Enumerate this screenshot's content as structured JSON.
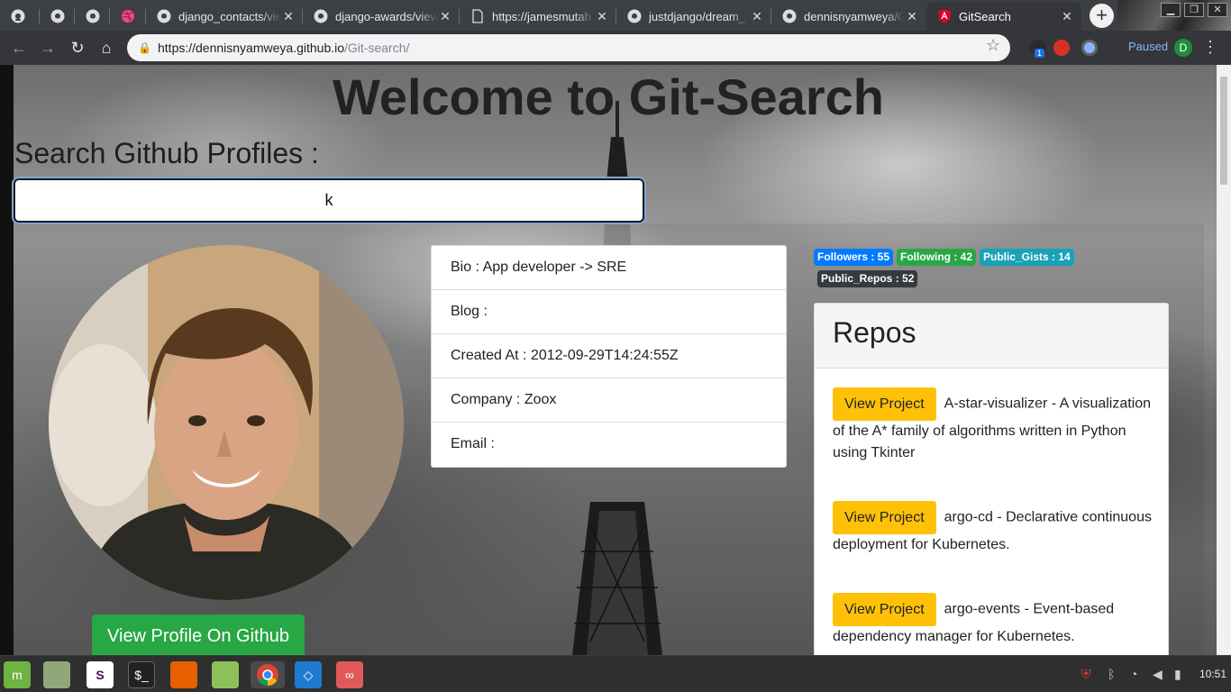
{
  "browser": {
    "tabs": [
      {
        "title": "",
        "icon": "github-icon"
      },
      {
        "title": "",
        "icon": "github-icon"
      },
      {
        "title": "",
        "icon": "github-icon"
      },
      {
        "title": "",
        "icon": "dribbble-icon"
      },
      {
        "title": "django_contacts/vie",
        "icon": "github-icon"
      },
      {
        "title": "django-awards/view",
        "icon": "github-icon"
      },
      {
        "title": "https://jamesmutah",
        "icon": "page-icon"
      },
      {
        "title": "justdjango/dream_",
        "icon": "github-icon"
      },
      {
        "title": "dennisnyamweya/G",
        "icon": "github-icon"
      },
      {
        "title": "GitSearch",
        "icon": "angular-icon"
      }
    ],
    "url_host": "https://dennisnyamweya.github.io",
    "url_path": "/Git-search/",
    "paused_label": "Paused",
    "profile_initial": "D",
    "extension_badge": "1"
  },
  "page": {
    "title": "Welcome to Git-Search",
    "search_label": "Search Github Profiles :",
    "search_value": "k",
    "view_profile_label": "View Profile On Github",
    "info": [
      "Bio : App developer -> SRE",
      "Blog :",
      "Created At : 2012-09-29T14:24:55Z",
      "Company : Zoox",
      "Email :"
    ],
    "badges": {
      "followers": "Followers : 55",
      "following": "Following : 42",
      "gists": "Public_Gists : 14",
      "repos": "Public_Repos : 52"
    },
    "repos_heading": "Repos",
    "view_project_label": "View Project",
    "repos": [
      {
        "text": "A-star-visualizer - A visualization of the A* family of algorithms written in Python using Tkinter"
      },
      {
        "text": "argo-cd - Declarative continuous deployment for Kubernetes."
      },
      {
        "text": "argo-events - Event-based dependency manager for Kubernetes."
      }
    ]
  },
  "colors": {
    "followers": "#007bff",
    "following": "#28a745",
    "gists": "#17a2b8",
    "repos": "#343a40",
    "view_project": "#ffc107",
    "view_github": "#28a745"
  },
  "taskbar": {
    "clock": "10:51",
    "apps": [
      "mint-menu-icon",
      "files-icon",
      "slack-icon",
      "terminal-icon",
      "firefox-icon",
      "folder-icon",
      "chrome-icon",
      "vscode-icon",
      "glasses-icon"
    ]
  }
}
